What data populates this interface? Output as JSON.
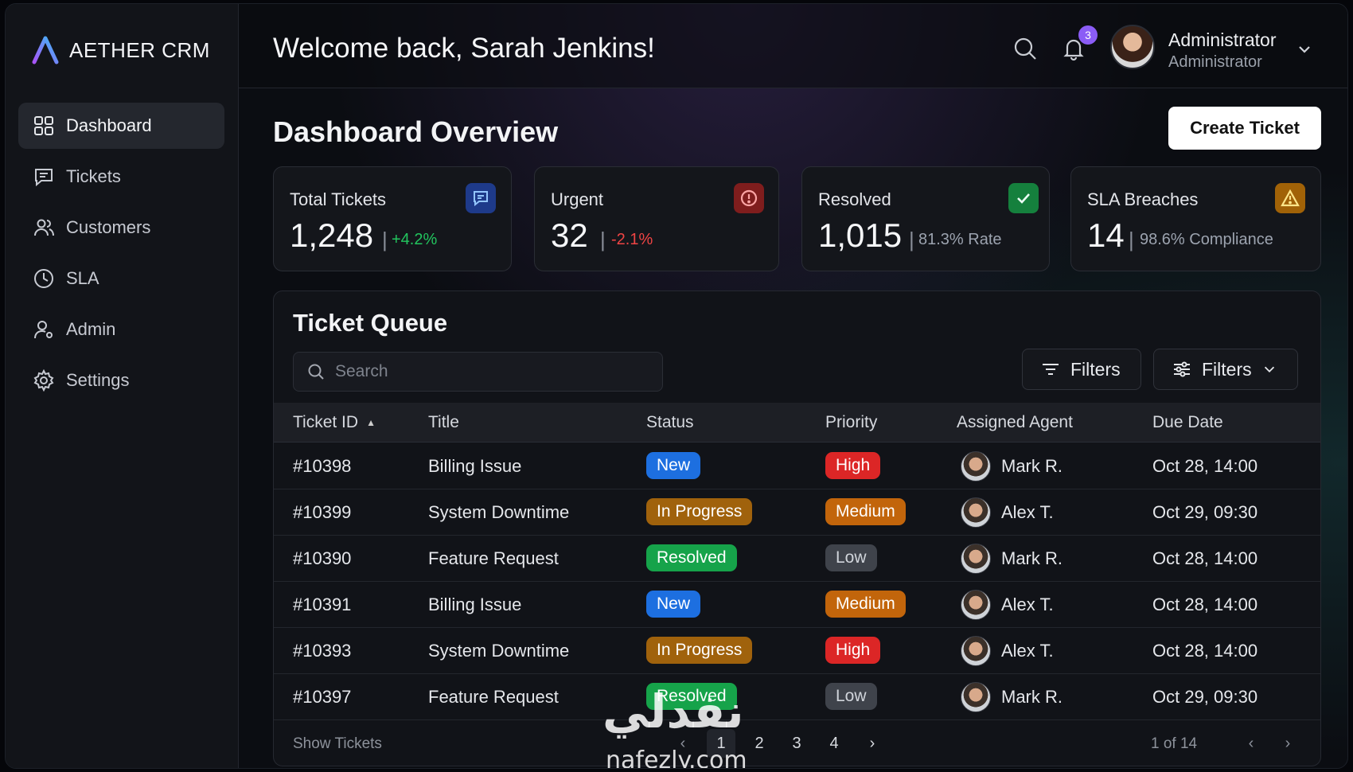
{
  "brand": {
    "name": "AETHER CRM"
  },
  "sidebar": {
    "items": [
      {
        "label": "Dashboard",
        "icon": "grid-icon",
        "active": true
      },
      {
        "label": "Tickets",
        "icon": "chat-icon"
      },
      {
        "label": "Customers",
        "icon": "users-icon"
      },
      {
        "label": "SLA",
        "icon": "clock-icon"
      },
      {
        "label": "Admin",
        "icon": "user-gear-icon"
      },
      {
        "label": "Settings",
        "icon": "gear-icon"
      }
    ]
  },
  "header": {
    "welcome": "Welcome back, Sarah Jenkins!",
    "notification_count": "3",
    "user_name": "Administrator",
    "user_role": "Administrator"
  },
  "main": {
    "title": "Dashboard Overview",
    "create_button": "Create Ticket"
  },
  "stats": [
    {
      "label": "Total Tickets",
      "value": "1,248",
      "sub": "+4.2%",
      "sub_color": "#22c55e",
      "icon": "chat-icon",
      "icon_color": "#3b82f6"
    },
    {
      "label": "Urgent",
      "value": "32",
      "sub": "-2.1%",
      "sub_color": "#ef4444",
      "icon": "alert-circle-icon",
      "icon_color": "#ef4444"
    },
    {
      "label": "Resolved",
      "value": "1,015",
      "sub": "81.3% Rate",
      "sub_color": "#9ca3af",
      "icon": "check-icon",
      "icon_color": "#16a34a"
    },
    {
      "label": "SLA Breaches",
      "value": "14",
      "sub": "98.6% Compliance",
      "sub_color": "#9ca3af",
      "icon": "warning-icon",
      "icon_color": "#eab308"
    }
  ],
  "queue": {
    "title": "Ticket Queue",
    "search_placeholder": "Search",
    "filter_button_1": "Filters",
    "filter_button_2": "Filters",
    "columns": [
      "Ticket ID",
      "Title",
      "Status",
      "Priority",
      "Assigned Agent",
      "Due Date"
    ],
    "rows": [
      {
        "id": "#10398",
        "title": "Billing Issue",
        "status": "New",
        "priority": "High",
        "agent": "Mark R.",
        "due": "Oct 28, 14:00"
      },
      {
        "id": "#10399",
        "title": "System Downtime",
        "status": "In Progress",
        "priority": "Medium",
        "agent": "Alex T.",
        "due": "Oct 29, 09:30"
      },
      {
        "id": "#10390",
        "title": "Feature Request",
        "status": "Resolved",
        "priority": "Low",
        "agent": "Mark R.",
        "due": "Oct 28, 14:00"
      },
      {
        "id": "#10391",
        "title": "Billing Issue",
        "status": "New",
        "priority": "Medium",
        "agent": "Alex T.",
        "due": "Oct 28, 14:00"
      },
      {
        "id": "#10393",
        "title": "System Downtime",
        "status": "In Progress",
        "priority": "High",
        "agent": "Alex T.",
        "due": "Oct 28, 14:00"
      },
      {
        "id": "#10397",
        "title": "Feature Request",
        "status": "Resolved",
        "priority": "Low",
        "agent": "Mark R.",
        "due": "Oct 29, 09:30"
      }
    ],
    "footer_label": "Show Tickets",
    "pages": [
      "1",
      "2",
      "3",
      "4"
    ],
    "current_page": "1",
    "page_count": "1 of 14"
  },
  "status_colors": {
    "New": "#1d6fe0",
    "In Progress": "#a0620c",
    "Resolved": "#16a34a"
  },
  "priority_colors": {
    "High": "#dc2626",
    "Medium": "#c2650b",
    "Low": "#3f434b"
  },
  "watermark": {
    "arabic": "نفدلي",
    "latin": "nafezly.com"
  }
}
